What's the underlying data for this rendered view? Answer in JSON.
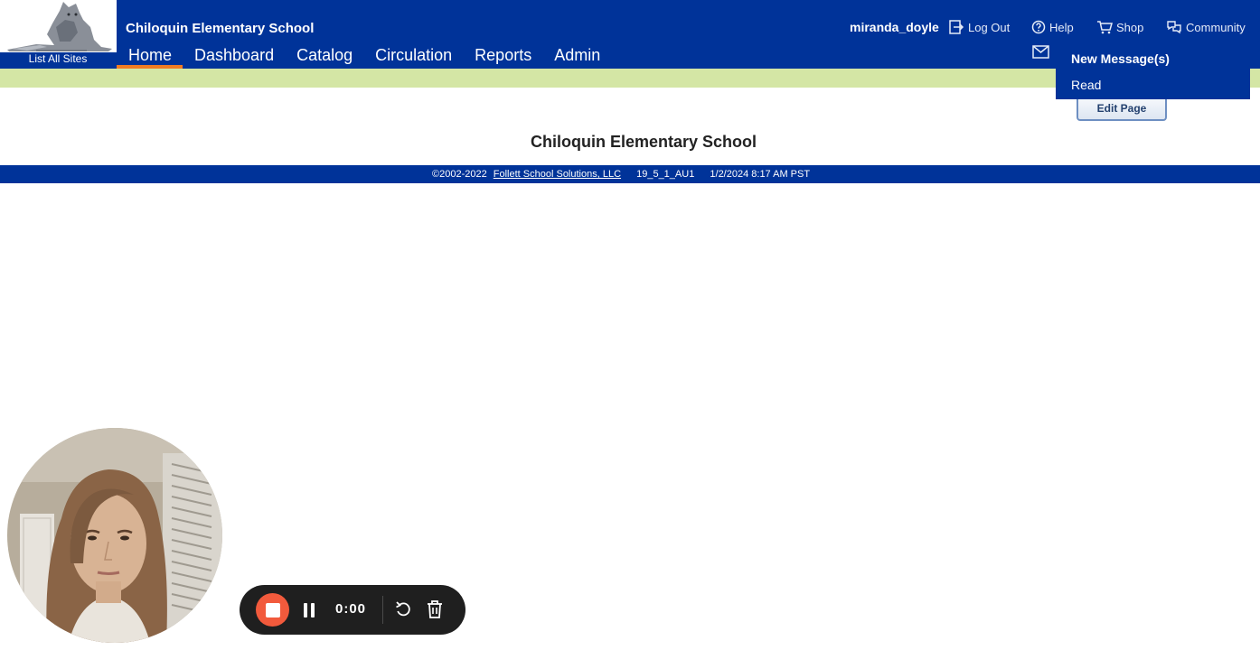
{
  "header": {
    "site_title": "Chiloquin Elementary School",
    "list_all_sites": "List All Sites",
    "user": "miranda_doyle",
    "top_links": {
      "logout": "Log Out",
      "help": "Help",
      "shop": "Shop",
      "community": "Community"
    }
  },
  "nav": {
    "items": [
      {
        "label": "Home",
        "active": true
      },
      {
        "label": "Dashboard"
      },
      {
        "label": "Catalog"
      },
      {
        "label": "Circulation"
      },
      {
        "label": "Reports"
      },
      {
        "label": "Admin"
      }
    ]
  },
  "messages_menu": {
    "items": [
      "New Message(s)",
      "Read"
    ]
  },
  "main": {
    "edit_page": "Edit Page",
    "title": "Chiloquin Elementary School"
  },
  "footer": {
    "copyright": "©2002-2022",
    "company_link": "Follett School Solutions, LLC",
    "version": "19_5_1_AU1",
    "datetime": "1/2/2024 8:17 AM PST"
  },
  "recorder": {
    "time": "0:00"
  },
  "icons": {
    "logout": "logout-icon",
    "help": "help-icon",
    "shop": "cart-icon",
    "community": "community-icon",
    "messages": "mail-icon",
    "stop": "stop-icon",
    "pause": "pause-icon",
    "restart": "restart-icon",
    "delete": "trash-icon"
  },
  "colors": {
    "header_blue": "#003399",
    "nav_active_underline": "#f07c22",
    "subheader_green": "#d4e6a5",
    "record_red": "#f25a3c",
    "recorder_bg": "#1f1f1f"
  }
}
